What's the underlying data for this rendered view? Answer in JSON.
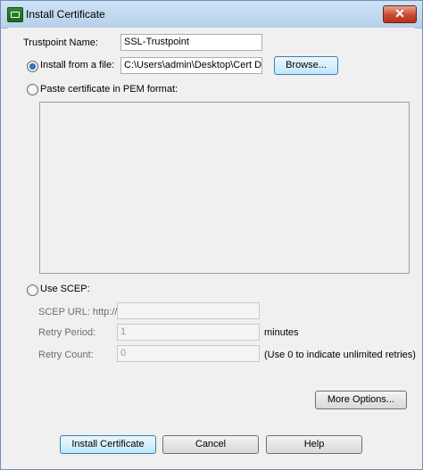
{
  "window": {
    "title": "Install Certificate",
    "close_glyph": "✕"
  },
  "form": {
    "trustpoint_label": "Trustpoint Name:",
    "trustpoint_value": "SSL-Trustpoint",
    "install_file_label": "Install from a file:",
    "file_path_value": "C:\\Users\\admin\\Desktop\\Cert Doc",
    "browse_label": "Browse...",
    "paste_pem_label": "Paste certificate in PEM format:",
    "use_scep_label": "Use SCEP:",
    "scep_url_label": "SCEP URL: http://",
    "scep_url_value": "",
    "retry_period_label": "Retry Period:",
    "retry_period_value": "1",
    "retry_period_unit": "minutes",
    "retry_count_label": "Retry Count:",
    "retry_count_value": "0",
    "retry_count_hint": "(Use 0 to indicate unlimited retries)",
    "selected_option": "install_from_file"
  },
  "buttons": {
    "more_options": "More Options...",
    "install": "Install Certificate",
    "cancel": "Cancel",
    "help": "Help"
  },
  "icons": {
    "title": "certificate-app-icon",
    "close": "close-icon"
  }
}
